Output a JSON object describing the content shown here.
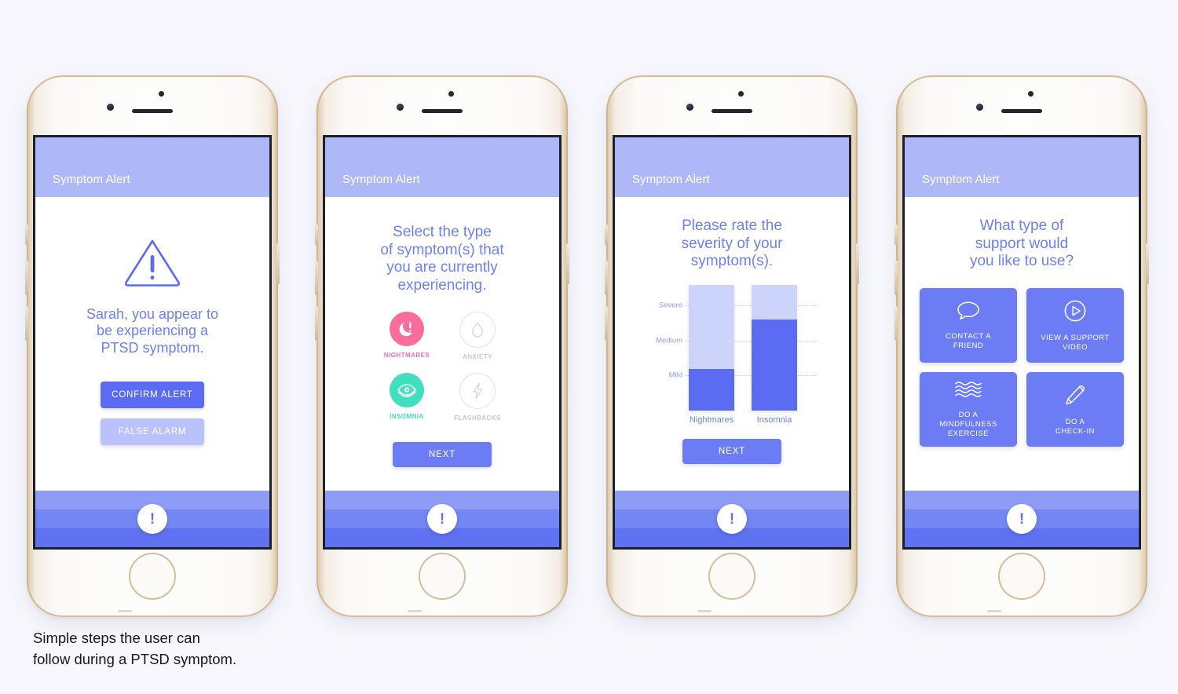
{
  "page": {
    "background": "#f7f7fd",
    "caption": "Simple steps the user can\nfollow during a PTSD symptom."
  },
  "theme": {
    "appbar": "#aeb8f9",
    "primary_blue": "#5b6cf2",
    "light_blue": "#b9c2fa",
    "headline_blue": "#6d80f2",
    "pink": "#f96d9c",
    "teal": "#3fdfc0",
    "muted": "#c6c8d1",
    "bar_track": "#ccd4fb"
  },
  "screens": [
    {
      "appbar_title": "Symptom Alert",
      "warning_icon": "warning-triangle-icon",
      "message": "Sarah, you appear to\nbe experiencing a\nPTSD symptom.",
      "buttons": [
        {
          "label": "CONFIRM ALERT",
          "style": "primary"
        },
        {
          "label": "FALSE ALARM",
          "style": "ghost"
        }
      ],
      "nav_icon": "alert-exclamation-icon"
    },
    {
      "appbar_title": "Symptom Alert",
      "headline": "Select the type\nof symptom(s) that\nyou are currently\nexperiencing.",
      "symptoms": [
        {
          "label": "NIGHTMARES",
          "icon": "moon-exclamation-icon",
          "state": "selected-pink"
        },
        {
          "label": "ANXIETY",
          "icon": "water-drop-icon",
          "state": "unselected"
        },
        {
          "label": "INSOMNIA",
          "icon": "eye-icon",
          "state": "selected-teal"
        },
        {
          "label": "FLASHBACKS",
          "icon": "lightning-bolt-icon",
          "state": "unselected"
        }
      ],
      "next_label": "NEXT",
      "nav_icon": "alert-exclamation-icon"
    },
    {
      "appbar_title": "Symptom Alert",
      "headline": "Please rate the\nseverity of your\nsymptom(s).",
      "next_label": "NEXT",
      "nav_icon": "alert-exclamation-icon"
    },
    {
      "appbar_title": "Symptom Alert",
      "headline": "What type of\nsupport would\nyou like to use?",
      "support_options": [
        {
          "label": "CONTACT A\nFRIEND",
          "icon": "speech-bubble-icon"
        },
        {
          "label": "VIEW A SUPPORT\nVIDEO",
          "icon": "play-circle-icon"
        },
        {
          "label": "DO A\nMINDFULNESS\nEXERCISE",
          "icon": "waves-icon"
        },
        {
          "label": "DO A\nCHECK-IN",
          "icon": "pencil-icon"
        }
      ],
      "nav_icon": "alert-exclamation-icon"
    }
  ],
  "chart_data": {
    "type": "bar",
    "title": "Please rate the severity of your symptom(s).",
    "categories": [
      "Nightmares",
      "Insomnia"
    ],
    "values": [
      1.2,
      2.6
    ],
    "tick_labels": [
      "Mild",
      "Medium",
      "Severe"
    ],
    "tick_values": [
      1,
      2,
      3
    ],
    "ylim": [
      0,
      3.6
    ],
    "xlabel": "",
    "ylabel": "",
    "grid": true,
    "legend": "none",
    "series": [
      {
        "name": "Severity",
        "values": [
          1.2,
          2.6
        ]
      }
    ],
    "bar_fill_color": "#5b6cf2",
    "bar_track_color": "#ccd4fb"
  }
}
